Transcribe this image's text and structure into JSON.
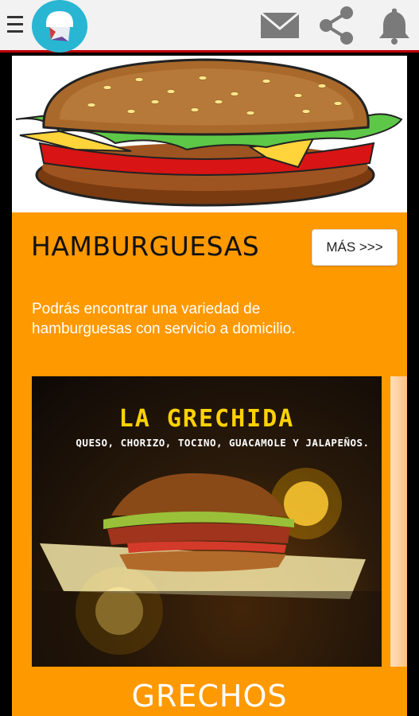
{
  "appbar": {
    "menu_icon": "hamburger-menu-icon",
    "logo_icon": "chef-hat-logo",
    "actions": [
      "mail-icon",
      "share-icon",
      "bell-icon"
    ],
    "accent_color": "#c00000",
    "logo_color": "#28b6d3"
  },
  "section": {
    "title": "HAMBURGUESAS",
    "more_label": "MÁS >>>",
    "description": "Podrás encontrar una variedad de hamburguesas con servicio a domicilio.",
    "background_color": "#ff9900"
  },
  "promo": {
    "title": "LA GRECHIDA",
    "subtitle": "QUESO, CHORIZO, TOCINO, GUACAMOLE Y JALAPEÑOS."
  },
  "store": {
    "name": "GRECHOS"
  }
}
